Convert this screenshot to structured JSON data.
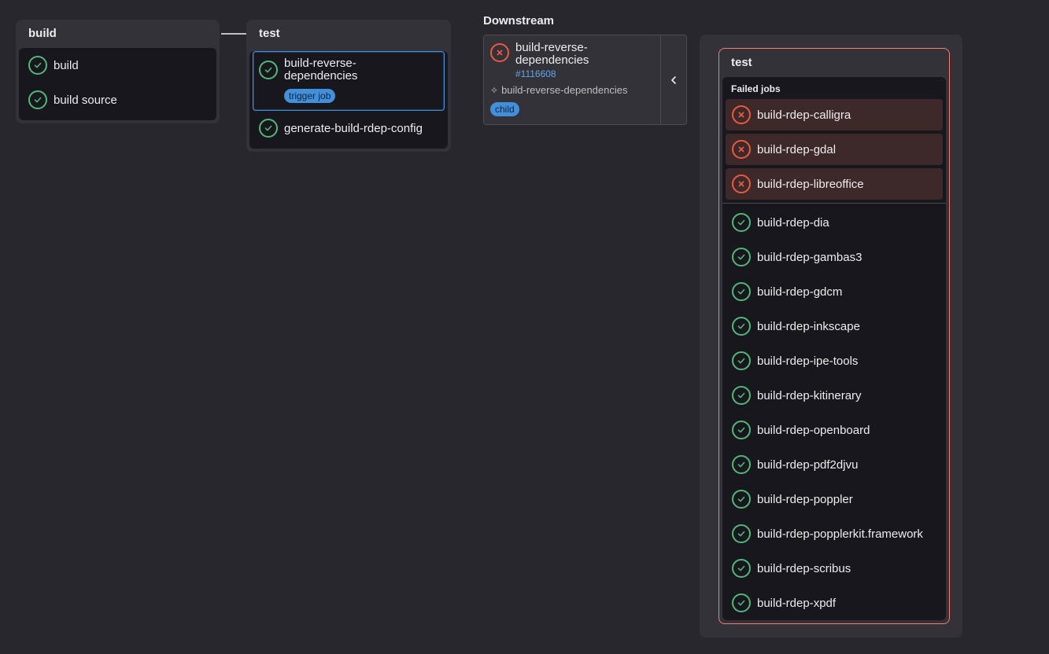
{
  "stages": {
    "build": {
      "title": "build",
      "jobs": [
        {
          "name": "build",
          "status": "success"
        },
        {
          "name": "build source",
          "status": "success"
        }
      ]
    },
    "test": {
      "title": "test",
      "trigger_job": {
        "name": "build-reverse-dependencies",
        "badge": "trigger job",
        "status": "success"
      },
      "jobs": [
        {
          "name": "generate-build-rdep-config",
          "status": "success"
        }
      ]
    }
  },
  "downstream": {
    "label": "Downstream",
    "pipeline": {
      "name": "build-reverse-dependencies",
      "id": "#1116608",
      "source_job": "build-reverse-dependencies",
      "badge": "child",
      "status": "failed"
    },
    "collapse_icon": "chevron-left-icon"
  },
  "expanded": {
    "title": "test",
    "failed_label": "Failed jobs",
    "failed_jobs": [
      {
        "name": "build-rdep-calligra",
        "status": "failed"
      },
      {
        "name": "build-rdep-gdal",
        "status": "failed"
      },
      {
        "name": "build-rdep-libreoffice",
        "status": "failed"
      }
    ],
    "jobs": [
      {
        "name": "build-rdep-dia",
        "status": "success"
      },
      {
        "name": "build-rdep-gambas3",
        "status": "success"
      },
      {
        "name": "build-rdep-gdcm",
        "status": "success"
      },
      {
        "name": "build-rdep-inkscape",
        "status": "success"
      },
      {
        "name": "build-rdep-ipe-tools",
        "status": "success"
      },
      {
        "name": "build-rdep-kitinerary",
        "status": "success"
      },
      {
        "name": "build-rdep-openboard",
        "status": "success"
      },
      {
        "name": "build-rdep-pdf2djvu",
        "status": "success"
      },
      {
        "name": "build-rdep-poppler",
        "status": "success"
      },
      {
        "name": "build-rdep-popplerkit.framework",
        "status": "success"
      },
      {
        "name": "build-rdep-scribus",
        "status": "success"
      },
      {
        "name": "build-rdep-xpdf",
        "status": "success"
      }
    ]
  },
  "colors": {
    "success": "#52b87a",
    "failed": "#ec5941",
    "accent": "#428fdc"
  }
}
